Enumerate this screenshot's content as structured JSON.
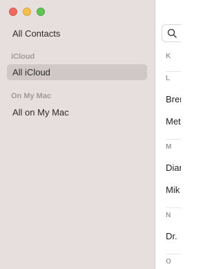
{
  "sidebar": {
    "all_contacts": "All Contacts",
    "sections": [
      {
        "title": "iCloud",
        "items": [
          "All iCloud"
        ]
      },
      {
        "title": "On My Mac",
        "items": [
          "All on My Mac"
        ]
      }
    ]
  },
  "list": {
    "groups": [
      {
        "letter": "K",
        "names": []
      },
      {
        "letter": "L",
        "names": [
          "Bren",
          "Met"
        ]
      },
      {
        "letter": "M",
        "names": [
          "Dian",
          "Mik"
        ]
      },
      {
        "letter": "N",
        "names": [
          "Dr. "
        ]
      },
      {
        "letter": "O",
        "names": []
      }
    ]
  },
  "colors": {
    "sidebar_bg": "#e7dfdd",
    "selected_bg": "#cfc8c6",
    "close": "#ed6a5e",
    "minimize": "#f5bf4f",
    "zoom": "#61c554"
  }
}
